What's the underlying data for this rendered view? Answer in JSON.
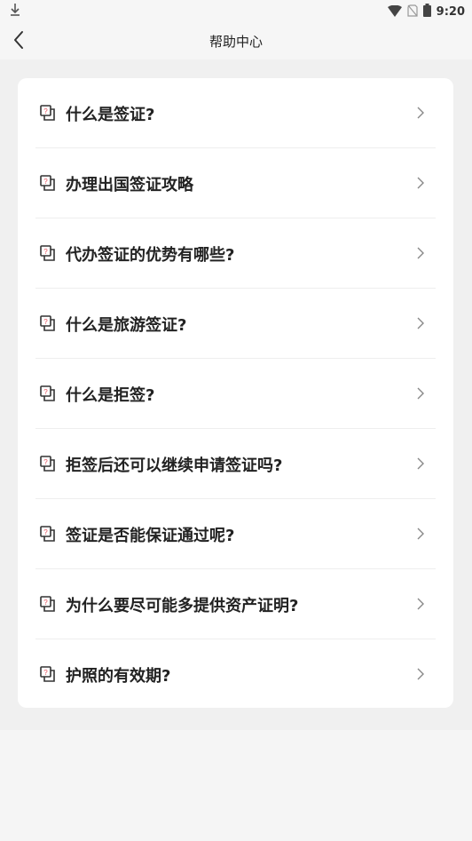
{
  "status": {
    "time": "9:20"
  },
  "header": {
    "title": "帮助中心"
  },
  "items": [
    {
      "label": "什么是签证?"
    },
    {
      "label": "办理出国签证攻略"
    },
    {
      "label": "代办签证的优势有哪些?"
    },
    {
      "label": "什么是旅游签证?"
    },
    {
      "label": "什么是拒签?"
    },
    {
      "label": "拒签后还可以继续申请签证吗?"
    },
    {
      "label": "签证是否能保证通过呢?"
    },
    {
      "label": "为什么要尽可能多提供资产证明?"
    },
    {
      "label": "护照的有效期?"
    }
  ],
  "colors": {
    "accent": "#e8505b",
    "text": "#222222",
    "background": "#f5f5f5"
  },
  "icons": {
    "back": "chevron-left-icon",
    "row": "question-copy-icon",
    "arrow": "chevron-right-icon"
  }
}
